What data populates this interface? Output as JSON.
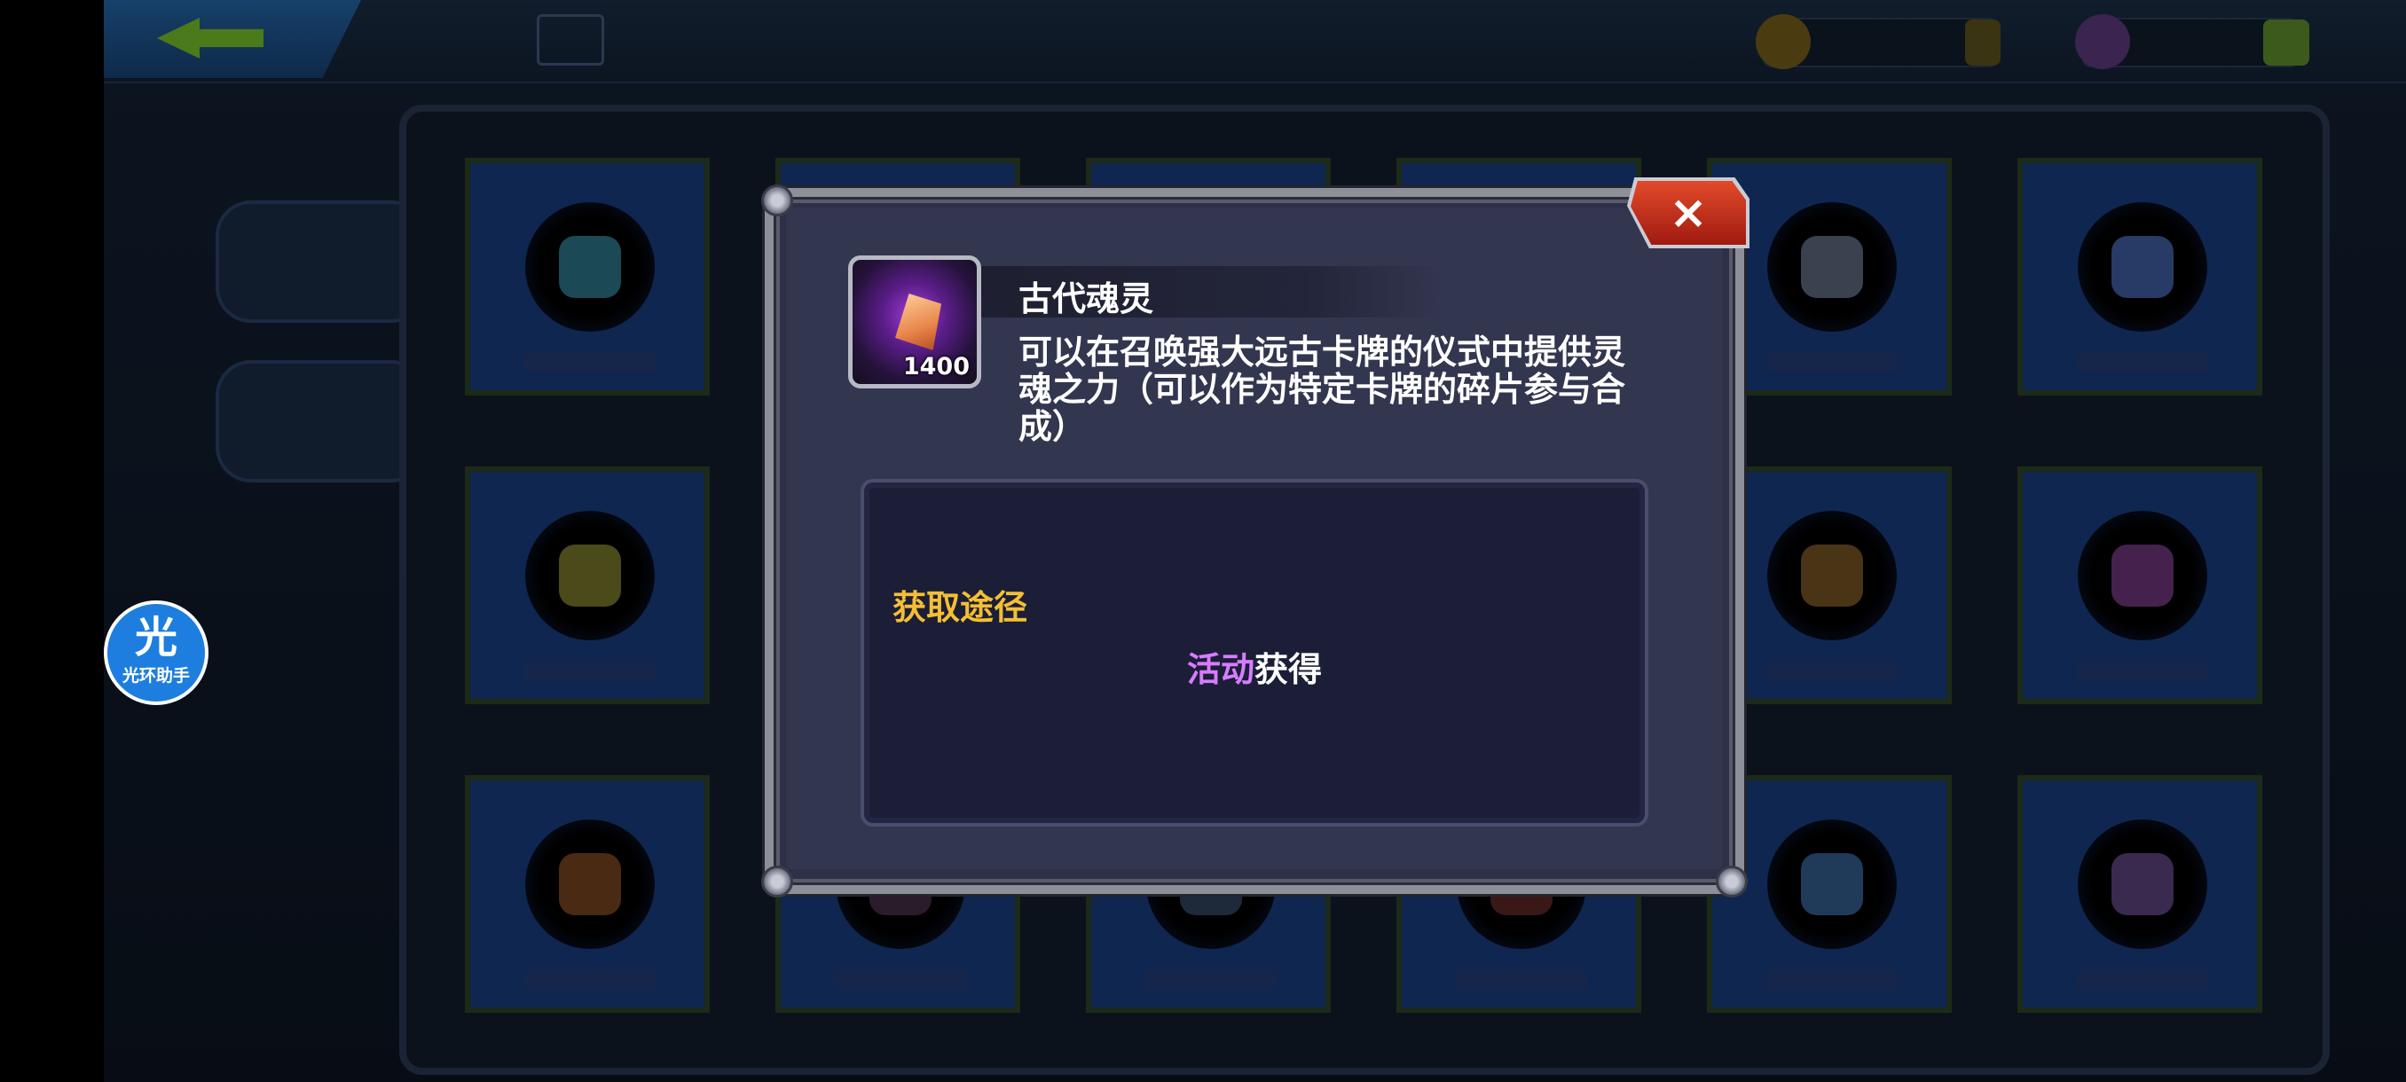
{
  "helper": {
    "glyph": "光",
    "label": "光环助手"
  },
  "dialog": {
    "item_name": "古代魂灵",
    "item_count": "1400",
    "description": "可以在召唤强大远古卡牌的仪式中提供灵魂之力（可以作为特定卡牌的碎片参与合成）",
    "close_label": "×",
    "source": {
      "title": "获取途径",
      "highlight": "活动",
      "suffix": "获得"
    }
  },
  "colors": {
    "highlight_text": "#d77cff",
    "source_title": "#f4bf34",
    "close_button": "#d23a1e",
    "dialog_bg": "#33364f"
  },
  "icons": {
    "item": "purple-soul-shard-icon",
    "close": "close-icon",
    "helper": "halo-assistant-icon"
  }
}
